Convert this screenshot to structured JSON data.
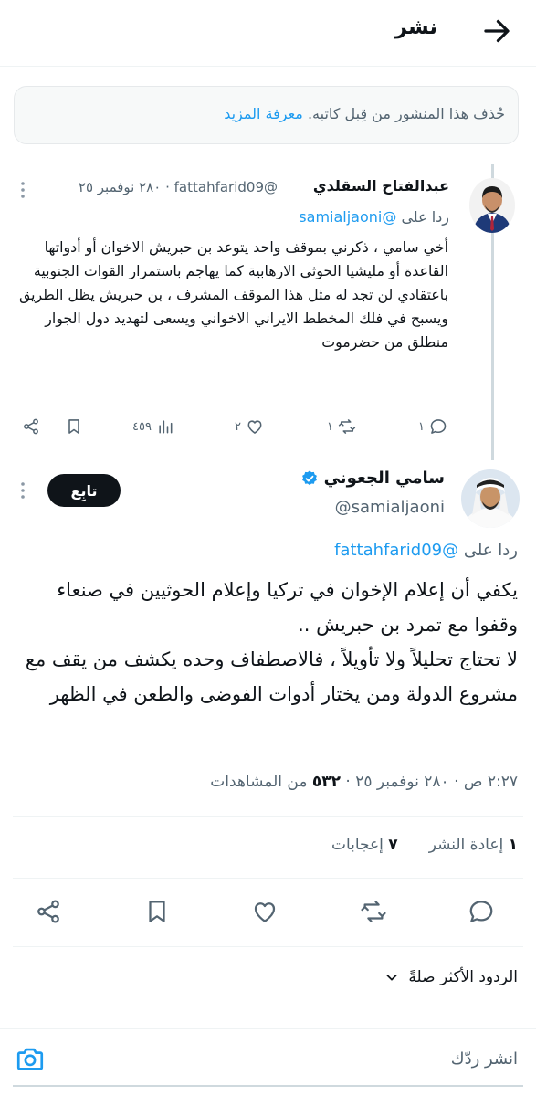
{
  "header": {
    "title": "نشر",
    "back_icon": "arrow-right-icon"
  },
  "notice": {
    "text": "حُذف هذا المنشور من قِبل كاتبه.",
    "link": "معرفة المزيد"
  },
  "parent_tweet": {
    "name": "عبدالفتاح السقلدي",
    "handle": "@fattahfarid09",
    "date": "٢٨٠ نوفمبر ٢٥",
    "meta_sep": "·",
    "reply_prefix": "ردا على",
    "reply_to": "@samialjaoni",
    "body": "أخي سامي ، ذكرني بموقف واحد يتوعد بن حبريش الاخوان أو أدواتها القاعدة أو مليشيا الحوثي الارهابية كما يهاجم باستمرار القوات الجنوبية باعتقادي لن تجد له مثل هذا الموقف المشرف ، بن حبريش يظل الطريق ويسبح في فلك المخطط الايراني الاخواني ويسعى لتهديد دول الجوار منطلق من حضرموت",
    "actions": {
      "replies": "١",
      "reposts": "١",
      "likes": "٢",
      "views": "٤٥٩"
    }
  },
  "main_tweet": {
    "name": "سامي الجعوني",
    "handle": "@samialjaoni",
    "follow_label": "تابِع",
    "reply_prefix": "ردا على",
    "reply_to": "@fattahfarid09",
    "body_lines": [
      "يكفي أن إعلام الإخوان في تركيا وإعلام الحوثيين في صنعاء وقفوا مع تمرد بن حبريش ..",
      "لا تحتاج تحليلاً ولا تأويلاً ، فالاصطفاف وحده يكشف من يقف مع مشروع الدولة ومن يختار أدوات الفوضى والطعن في الظهر"
    ],
    "time": "٢:٢٧ ص",
    "date": "٢٨٠ نوفمبر ٢٥",
    "sep": "·",
    "views_count": "٥٣٢",
    "views_label": "من المشاهدات",
    "stats": {
      "reposts_count": "١",
      "reposts_label": "إعادة النشر",
      "likes_count": "٧",
      "likes_label": "إعجابات"
    }
  },
  "replies_sort": {
    "label": "الردود الأكثر صلةً"
  },
  "composer": {
    "placeholder": "انشر ردّك"
  },
  "colors": {
    "accent": "#1d9bf0",
    "text": "#0f1419",
    "muted": "#536471",
    "border": "#eff3f4"
  }
}
